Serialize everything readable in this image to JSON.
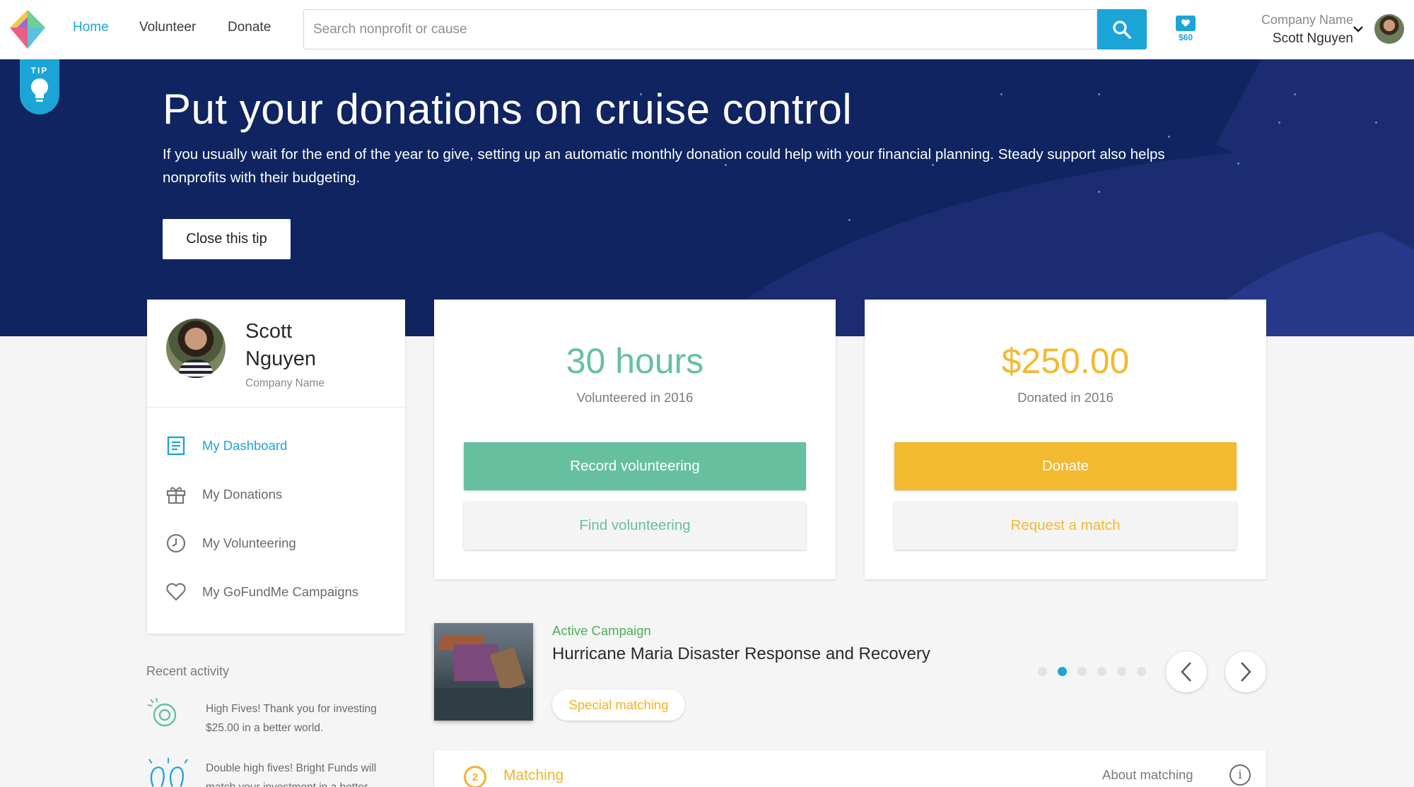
{
  "nav": {
    "links": [
      {
        "label": "Home",
        "active": true
      },
      {
        "label": "Volunteer",
        "active": false
      },
      {
        "label": "Donate",
        "active": false
      }
    ],
    "search_placeholder": "Search nonprofit or cause",
    "search_icon": "search-icon",
    "wallet_amount": "$60",
    "user_company": "Company Name",
    "user_name": "Scott Nguyen"
  },
  "tip": {
    "flag_label": "TIP",
    "title": "Put your donations on cruise control",
    "text": "If you usually wait for the end of the year to give, setting up an automatic monthly donation could help with your financial planning. Steady support also helps nonprofits with their budgeting.",
    "close_label": "Close this tip"
  },
  "profile": {
    "first_name": "Scott",
    "last_name": "Nguyen",
    "company": "Company Name",
    "menu": [
      {
        "label": "My Dashboard",
        "icon": "dashboard-icon",
        "active": true
      },
      {
        "label": "My Donations",
        "icon": "gift-icon",
        "active": false
      },
      {
        "label": "My Volunteering",
        "icon": "clock-icon",
        "active": false
      },
      {
        "label": "My GoFundMe Campaigns",
        "icon": "heart-icon",
        "active": false
      }
    ]
  },
  "volunteering": {
    "value": "30 hours",
    "label": "Volunteered in 2016",
    "primary_label": "Record volunteering",
    "secondary_label": "Find volunteering",
    "color": "#66c0a0"
  },
  "donations": {
    "value": "$250.00",
    "label": "Donated in 2016",
    "primary_label": "Donate",
    "secondary_label": "Request a match",
    "color": "#f3b92f"
  },
  "recent": {
    "title": "Recent activity",
    "items": [
      {
        "text": "High Fives! Thank you for investing $25.00 in a better world.",
        "icon": "high-five-icon"
      },
      {
        "text": "Double high fives! Bright Funds will match your investment in a better",
        "icon": "double-high-five-icon"
      }
    ]
  },
  "campaign": {
    "kicker": "Active Campaign",
    "title": "Hurricane Maria Disaster Response and Recovery",
    "pill": "Special matching",
    "slide_count": 6,
    "active_slide": 2
  },
  "matching": {
    "step": "2",
    "title": "Matching",
    "about_label": "About matching"
  }
}
